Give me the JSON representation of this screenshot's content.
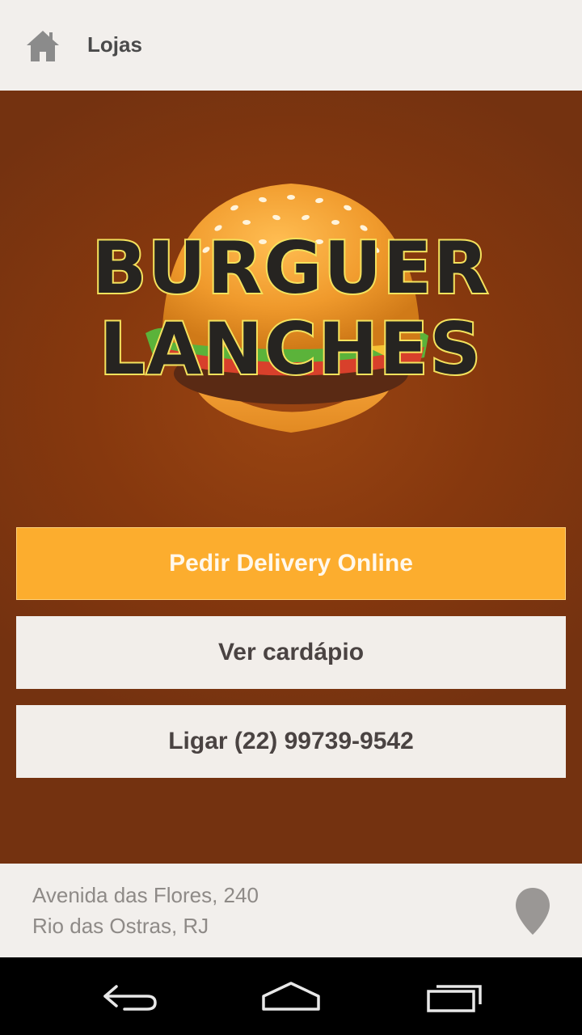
{
  "app_bar": {
    "title": "Lojas",
    "home_icon": "home-icon"
  },
  "logo": {
    "line1": "BURGUER",
    "line2": "LANCHES"
  },
  "buttons": {
    "delivery": "Pedir Delivery Online",
    "menu": "Ver cardápio",
    "call": "Ligar (22) 99739-9542"
  },
  "address": {
    "street": "Avenida das Flores, 240",
    "city": "Rio das Ostras, RJ",
    "pin_icon": "map-pin-icon"
  },
  "nav": {
    "back_icon": "back-icon",
    "home_icon": "home-icon",
    "recents_icon": "recents-icon"
  },
  "colors": {
    "accent": "#fcad2e",
    "background": "#86380e",
    "surface": "#f2efec"
  }
}
